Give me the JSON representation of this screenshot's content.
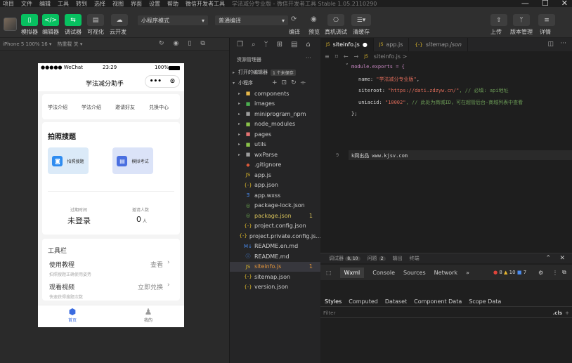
{
  "menubar": {
    "items": [
      "项目",
      "文件",
      "编辑",
      "工具",
      "转到",
      "选择",
      "视图",
      "界面",
      "设置",
      "帮助",
      "微信开发者工具"
    ],
    "window_title": "学法减分专业版 - 微信开发者工具 Stable 1.05.2110290"
  },
  "toolbar": {
    "btn_simulator": "模拟器",
    "btn_editor": "编辑器",
    "btn_debugger": "调试器",
    "btn_visual": "可视化",
    "btn_cloud": "云开发",
    "mode_select": "小程序模式",
    "compile_select": "普通编译",
    "btn_compile": "编译",
    "btn_preview": "预览",
    "btn_realdebug": "真机调试",
    "btn_clearcache": "清缓存",
    "btn_upload": "上传",
    "btn_version": "版本管理",
    "btn_details": "详情"
  },
  "simulator": {
    "device": "iPhone 5 100% 16 ▾",
    "hotreload": "热重载 关 ▾",
    "status_carrier": "●●●●● WeChat",
    "status_time": "23:29",
    "status_battery": "100%",
    "page_title": "学法减分助手",
    "quick_tabs": [
      "学法介绍",
      "学法介绍",
      "邀请好友",
      "兑换中心"
    ],
    "section_title": "拍照搜题",
    "btn_photo": "拍照搜题",
    "btn_mock": "模拟考试",
    "stat_expire_label": "过期时间",
    "stat_expire_value": "未登录",
    "stat_invite_label": "邀请人数",
    "stat_invite_value": "0",
    "stat_invite_unit": "人",
    "tools_title": "工具栏",
    "row1_label": "使用教程",
    "row1_sub": "拍照搜题正确使用姿势",
    "row1_action": "查看",
    "row2_label": "观看视频",
    "row2_sub": "快速获得搜题次数",
    "row2_action": "立即兑换",
    "tab_home": "首页",
    "tab_me": "我的"
  },
  "explorer": {
    "title": "资源管理器",
    "open_editors": "打开的编辑器",
    "unsaved_badge": "1 个未保存",
    "root": "小程序",
    "items": [
      {
        "name": "components",
        "type": "folder",
        "color": "#e8b84a"
      },
      {
        "name": "images",
        "type": "folder",
        "color": "#4caf50"
      },
      {
        "name": "miniprogram_npm",
        "type": "folder",
        "color": "#9e9e9e"
      },
      {
        "name": "node_modules",
        "type": "folder",
        "color": "#8bc34a"
      },
      {
        "name": "pages",
        "type": "folder",
        "color": "#e57373"
      },
      {
        "name": "utils",
        "type": "folder",
        "color": "#8bc34a"
      },
      {
        "name": "wxParse",
        "type": "folder",
        "color": "#9e9e9e"
      },
      {
        "name": ".gitignore",
        "type": "file",
        "icon": "◆",
        "color": "#e05a3a"
      },
      {
        "name": "app.js",
        "type": "file",
        "icon": "JS",
        "color": "#d7b32b"
      },
      {
        "name": "app.json",
        "type": "file",
        "icon": "{-}",
        "color": "#d7b32b"
      },
      {
        "name": "app.wxss",
        "type": "file",
        "icon": "Ǝ",
        "color": "#4a8cf0"
      },
      {
        "name": "package-lock.json",
        "type": "file",
        "icon": "◎",
        "color": "#6aa84f"
      },
      {
        "name": "package.json",
        "type": "file",
        "icon": "◎",
        "color": "#6aa84f",
        "badge": "1",
        "highlight": "#d8c25a"
      },
      {
        "name": "project.config.json",
        "type": "file",
        "icon": "{-}",
        "color": "#d7b32b"
      },
      {
        "name": "project.private.config.js...",
        "type": "file",
        "icon": "{-}",
        "color": "#d7b32b"
      },
      {
        "name": "README.en.md",
        "type": "file",
        "icon": "M↓",
        "color": "#4a8cf0"
      },
      {
        "name": "README.md",
        "type": "file",
        "icon": "ⓘ",
        "color": "#4a8cf0"
      },
      {
        "name": "siteinfo.js",
        "type": "file",
        "icon": "JS",
        "color": "#d7b32b",
        "badge": "1",
        "highlight": "#e0933a",
        "selected": true
      },
      {
        "name": "sitemap.json",
        "type": "file",
        "icon": "{-}",
        "color": "#d7b32b"
      },
      {
        "name": "version.json",
        "type": "file",
        "icon": "{-}",
        "color": "#d7b32b"
      }
    ]
  },
  "editor": {
    "tabs": [
      {
        "name": "siteinfo.js",
        "icon": "JS",
        "active": true,
        "dirty": "●"
      },
      {
        "name": "app.js",
        "icon": "JS",
        "active": false,
        "dirty": ""
      },
      {
        "name": "sitemap.json",
        "icon": "{-}",
        "active": false,
        "dirty": ""
      }
    ],
    "breadcrumb": "siteinfo.js >",
    "code": {
      "l1": "module.exports = {",
      "l2_key": "name: ",
      "l2_val": "\"学法减分专业版\"",
      "l2_end": ",",
      "l3_key": "siteroot: ",
      "l3_val": "\"https://dati.zdzyw.cn/\"",
      "l3_comment": ", // 必填: api地址",
      "l4_key": "uniacid: ",
      "l4_val": "\"10002\"",
      "l4_comment": ", // 此处为商城ID，可在超管后台-商城列表中查看",
      "l5": "};",
      "l9_num": "9",
      "l9": "k网出品 www.kjsv.com"
    }
  },
  "devtools": {
    "debug_label": "调试器",
    "debug_badge": "8, 10",
    "issues_label": "问题",
    "issues_badge": "2",
    "output_label": "输出",
    "terminal_label": "终端",
    "tabs": [
      "Wxml",
      "Console",
      "Sources",
      "Network",
      "»"
    ],
    "errors": "8",
    "warnings": "10",
    "infos": "7",
    "style_tabs": [
      "Styles",
      "Computed",
      "Dataset",
      "Component Data",
      "Scope Data"
    ],
    "filter_placeholder": "Filter",
    "cls": ".cls"
  }
}
